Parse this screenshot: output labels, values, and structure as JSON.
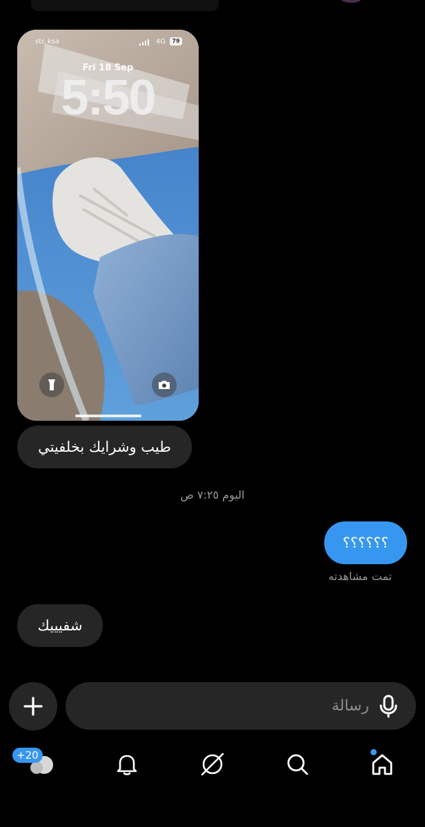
{
  "shared_screenshot": {
    "carrier": "stc ksa",
    "network": "4G",
    "battery": "79",
    "date": "Fri 18 Sep",
    "time": "5:50"
  },
  "messages": {
    "incoming_1": "طيب وشرايك بخلفيتي",
    "timestamp": "اليوم ٧:٢٥ ص",
    "outgoing_1": "؟؟؟؟؟؟",
    "seen_status": "تمت مشاهدته",
    "incoming_2": "شفيييك"
  },
  "composer": {
    "placeholder": "رسالة"
  },
  "nav": {
    "messages_badge": "+20",
    "items": [
      "messages-icon",
      "notifications-icon",
      "explore-icon",
      "search-icon",
      "home-icon"
    ]
  },
  "colors": {
    "background": "#000000",
    "bubble_incoming": "#262626",
    "bubble_outgoing": "#3797f0",
    "accent": "#3797f0"
  }
}
